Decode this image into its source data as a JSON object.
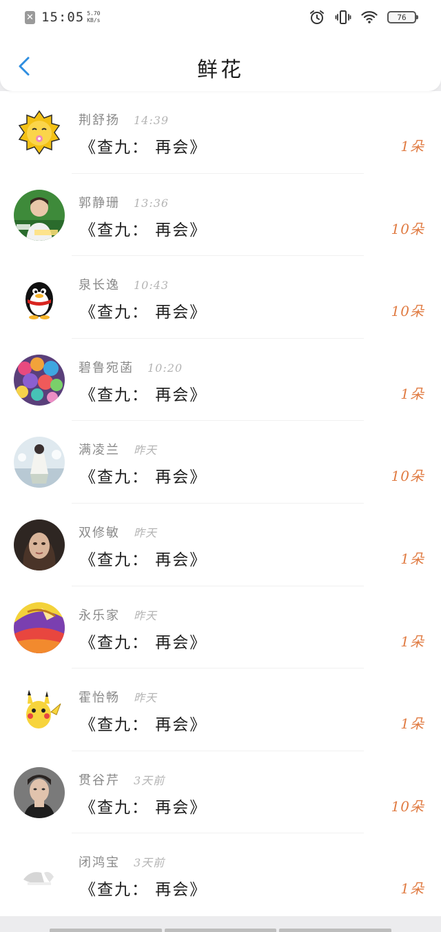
{
  "status_bar": {
    "time": "15:05",
    "speed_value": "5.70",
    "speed_unit": "KB/s",
    "battery_level": "76",
    "icons": [
      "close-box-icon",
      "alarm-icon",
      "vibrate-icon",
      "wifi-icon",
      "battery-icon"
    ]
  },
  "header": {
    "title": "鲜花",
    "back_icon": "chevron-left-icon",
    "accent_color": "#2f8ee0"
  },
  "colors": {
    "count": "#e07b42",
    "name": "#8a8a8a",
    "gift_text": "#1e1e1e"
  },
  "items": [
    {
      "name": "荆舒扬",
      "time": "14:39",
      "gift": "《查九： 再会》",
      "count": "1朵",
      "avatar": "cartoon-lion-avatar"
    },
    {
      "name": "郭静珊",
      "time": "13:36",
      "gift": "《查九： 再会》",
      "count": "10朵",
      "avatar": "boy-outdoor-photo-avatar"
    },
    {
      "name": "泉长逸",
      "time": "10:43",
      "gift": "《查九： 再会》",
      "count": "10朵",
      "avatar": "qq-penguin-avatar"
    },
    {
      "name": "碧鲁宛菡",
      "time": "10:20",
      "gift": "《查九： 再会》",
      "count": "1朵",
      "avatar": "balloons-avatar"
    },
    {
      "name": "满凌兰",
      "time": "昨天",
      "gift": "《查九： 再会》",
      "count": "10朵",
      "avatar": "anime-girl-avatar"
    },
    {
      "name": "双修敏",
      "time": "昨天",
      "gift": "《查九： 再会》",
      "count": "1朵",
      "avatar": "girl-portrait-avatar"
    },
    {
      "name": "永乐家",
      "time": "昨天",
      "gift": "《查九： 再会》",
      "count": "1朵",
      "avatar": "colored-pencils-avatar"
    },
    {
      "name": "霍怡畅",
      "time": "昨天",
      "gift": "《查九： 再会》",
      "count": "1朵",
      "avatar": "pikachu-avatar"
    },
    {
      "name": "贯谷芹",
      "time": "3天前",
      "gift": "《查九： 再会》",
      "count": "10朵",
      "avatar": "young-man-portrait-avatar"
    },
    {
      "name": "闭鸿宝",
      "time": "3天前",
      "gift": "《查九： 再会》",
      "count": "1朵",
      "avatar": "faded-sketch-avatar"
    }
  ]
}
